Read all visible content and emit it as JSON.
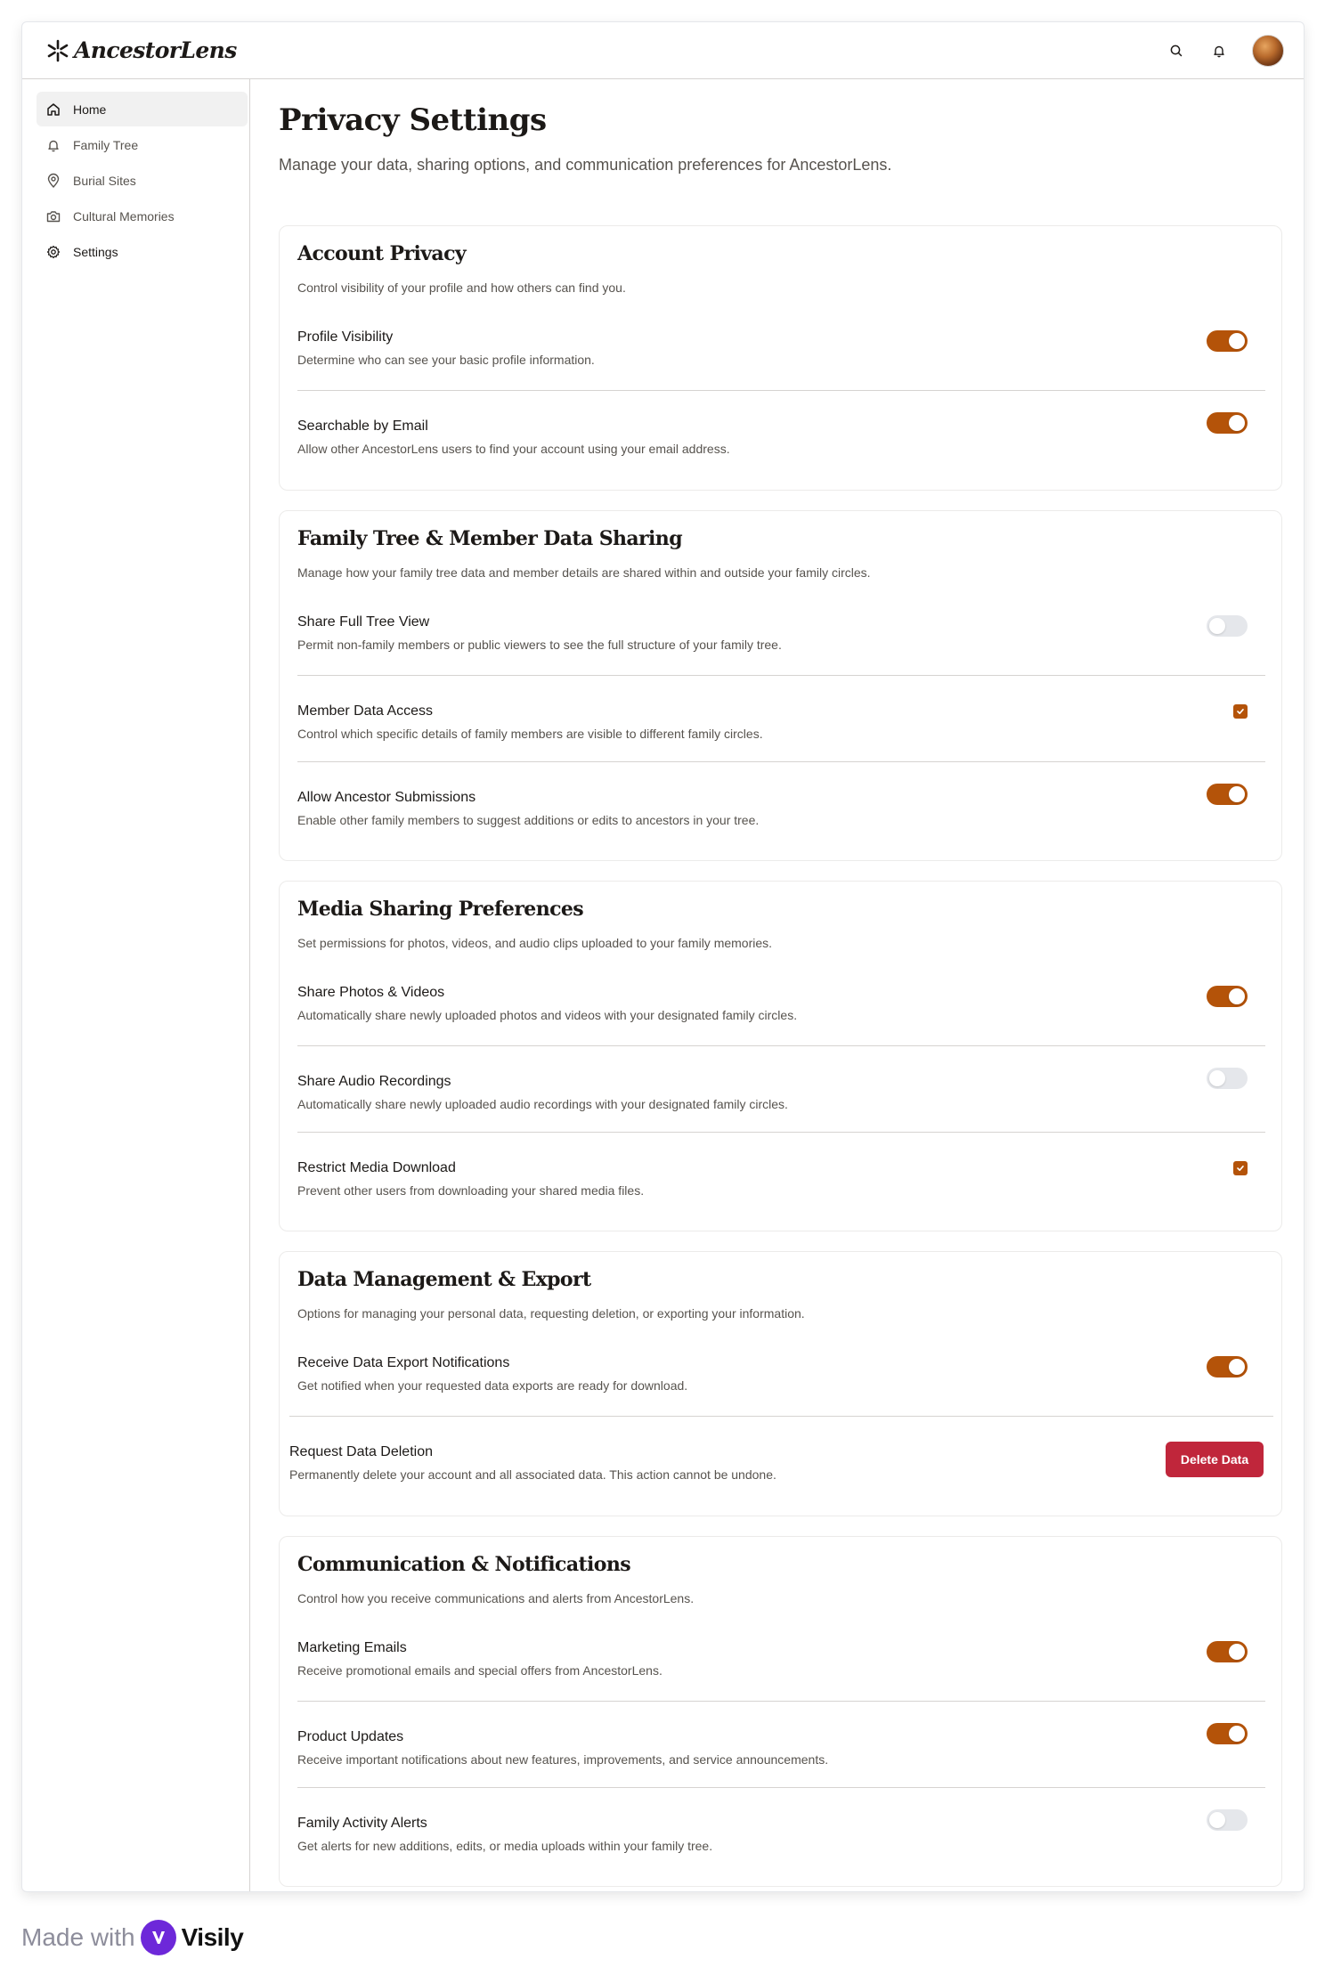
{
  "app": {
    "name": "AncestorLens"
  },
  "topbar": {
    "icons": [
      "search-icon",
      "bell-icon"
    ],
    "avatar": "user-avatar"
  },
  "sidebar": {
    "items": [
      {
        "label": "Home",
        "icon": "home-icon",
        "active": true
      },
      {
        "label": "Family Tree",
        "icon": "bell-icon",
        "active": false
      },
      {
        "label": "Burial Sites",
        "icon": "map-pin-icon",
        "active": false
      },
      {
        "label": "Cultural Memories",
        "icon": "camera-icon",
        "active": false
      },
      {
        "label": "Settings",
        "icon": "gear-icon",
        "active": false
      }
    ]
  },
  "page": {
    "title": "Privacy Settings",
    "subtitle": "Manage your data, sharing options, and communication preferences for AncestorLens."
  },
  "sections": [
    {
      "title": "Account Privacy",
      "description": "Control visibility of your profile and how others can find you.",
      "rows": [
        {
          "label": "Profile Visibility",
          "description": "Determine who can see your basic profile information.",
          "control": "toggle",
          "on": true
        },
        {
          "label": "Searchable by Email",
          "description": "Allow other AncestorLens users to find your account using your email address.",
          "control": "toggle",
          "on": true
        }
      ]
    },
    {
      "title": "Family Tree & Member Data Sharing",
      "description": "Manage how your family tree data and member details are shared within and outside your family circles.",
      "rows": [
        {
          "label": "Share Full Tree View",
          "description": "Permit non-family members or public viewers to see the full structure of your family tree.",
          "control": "toggle",
          "on": false
        },
        {
          "label": "Member Data Access",
          "description": "Control which specific details of family members are visible to different family circles.",
          "control": "checkbox",
          "on": true
        },
        {
          "label": "Allow Ancestor Submissions",
          "description": "Enable other family members to suggest additions or edits to ancestors in your tree.",
          "control": "toggle",
          "on": true
        }
      ]
    },
    {
      "title": "Media Sharing Preferences",
      "description": "Set permissions for photos, videos, and audio clips uploaded to your family memories.",
      "rows": [
        {
          "label": "Share Photos & Videos",
          "description": "Automatically share newly uploaded photos and videos with your designated family circles.",
          "control": "toggle",
          "on": true
        },
        {
          "label": "Share Audio Recordings",
          "description": "Automatically share newly uploaded audio recordings with your designated family circles.",
          "control": "toggle",
          "on": false
        },
        {
          "label": "Restrict Media Download",
          "description": "Prevent other users from downloading your shared media files.",
          "control": "checkbox",
          "on": true
        }
      ]
    },
    {
      "title": "Data Management & Export",
      "description": "Options for managing your personal data, requesting deletion, or exporting your information.",
      "rows": [
        {
          "label": "Receive Data Export Notifications",
          "description": "Get notified when your requested data exports are ready for download.",
          "control": "toggle",
          "on": true
        },
        {
          "label": "Request Data Deletion",
          "description": "Permanently delete your account and all associated data. This action cannot be undone.",
          "control": "button",
          "button_label": "Delete Data"
        }
      ]
    },
    {
      "title": "Communication & Notifications",
      "description": "Control how you receive communications and alerts from AncestorLens.",
      "rows": [
        {
          "label": "Marketing Emails",
          "description": "Receive promotional emails and special offers from AncestorLens.",
          "control": "toggle",
          "on": true
        },
        {
          "label": "Product Updates",
          "description": "Receive important notifications about new features, improvements, and service announcements.",
          "control": "toggle",
          "on": true
        },
        {
          "label": "Family Activity Alerts",
          "description": "Get alerts for new additions, edits, or media uploads within your family tree.",
          "control": "toggle",
          "on": false
        }
      ]
    }
  ],
  "footer": {
    "made_with": "Made with",
    "brand": "Visily"
  },
  "colors": {
    "accent": "#b45309",
    "danger": "#c0263b",
    "toggle_off": "#e5e7eb",
    "muted_text": "#57534e",
    "border": "#d6d3d1"
  }
}
